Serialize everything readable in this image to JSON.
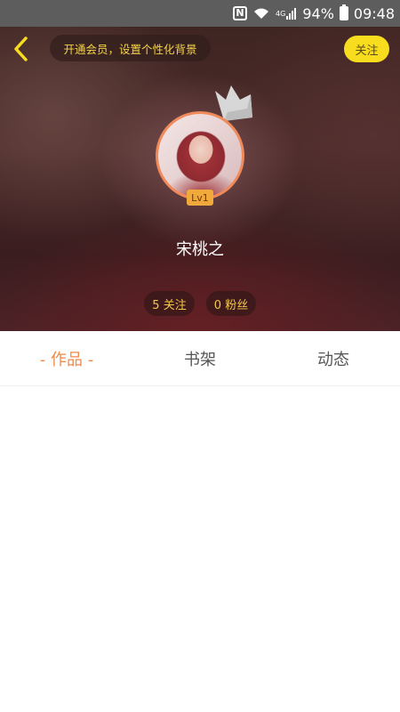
{
  "status_bar": {
    "battery": "94%",
    "time": "09:48",
    "signal_label": "4G",
    "nfc_label": "N"
  },
  "header": {
    "vip_banner": "开通会员，设置个性化背景",
    "follow_label": "关注"
  },
  "profile": {
    "level": "Lv1",
    "username": "宋桃之",
    "following": "5 关注",
    "fans": "0 粉丝"
  },
  "tabs": [
    {
      "label": "- 作品 -",
      "active": true
    },
    {
      "label": "书架",
      "active": false
    },
    {
      "label": "动态",
      "active": false
    }
  ],
  "colors": {
    "accent": "#f08a4a",
    "follow_bg": "#f7dd1e",
    "vip_text": "#f4d24a",
    "level_badge": "#f2a93b"
  },
  "icons": {
    "back": "chevron-left-icon",
    "crown": "crown-icon",
    "wifi": "wifi-icon",
    "battery": "battery-icon"
  }
}
